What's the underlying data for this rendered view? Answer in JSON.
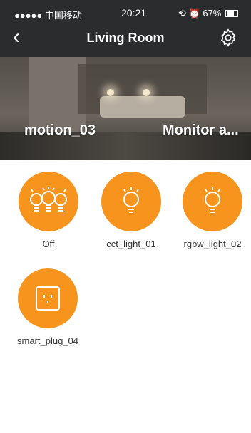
{
  "status": {
    "carrier": "●●●●● 中国移动",
    "time": "20:21",
    "battery": "67%"
  },
  "nav": {
    "title": "Living Room"
  },
  "hero": {
    "left_label": "motion_03",
    "right_label": "Monitor a..."
  },
  "devices": [
    {
      "label": "Off",
      "icon": "triple-bulb-icon"
    },
    {
      "label": "cct_light_01",
      "icon": "bulb-icon"
    },
    {
      "label": "rgbw_light_02",
      "icon": "bulb-icon"
    },
    {
      "label": "smart_plug_04",
      "icon": "plug-icon"
    }
  ],
  "colors": {
    "accent": "#f7941e",
    "bar": "#2b2c2e"
  }
}
